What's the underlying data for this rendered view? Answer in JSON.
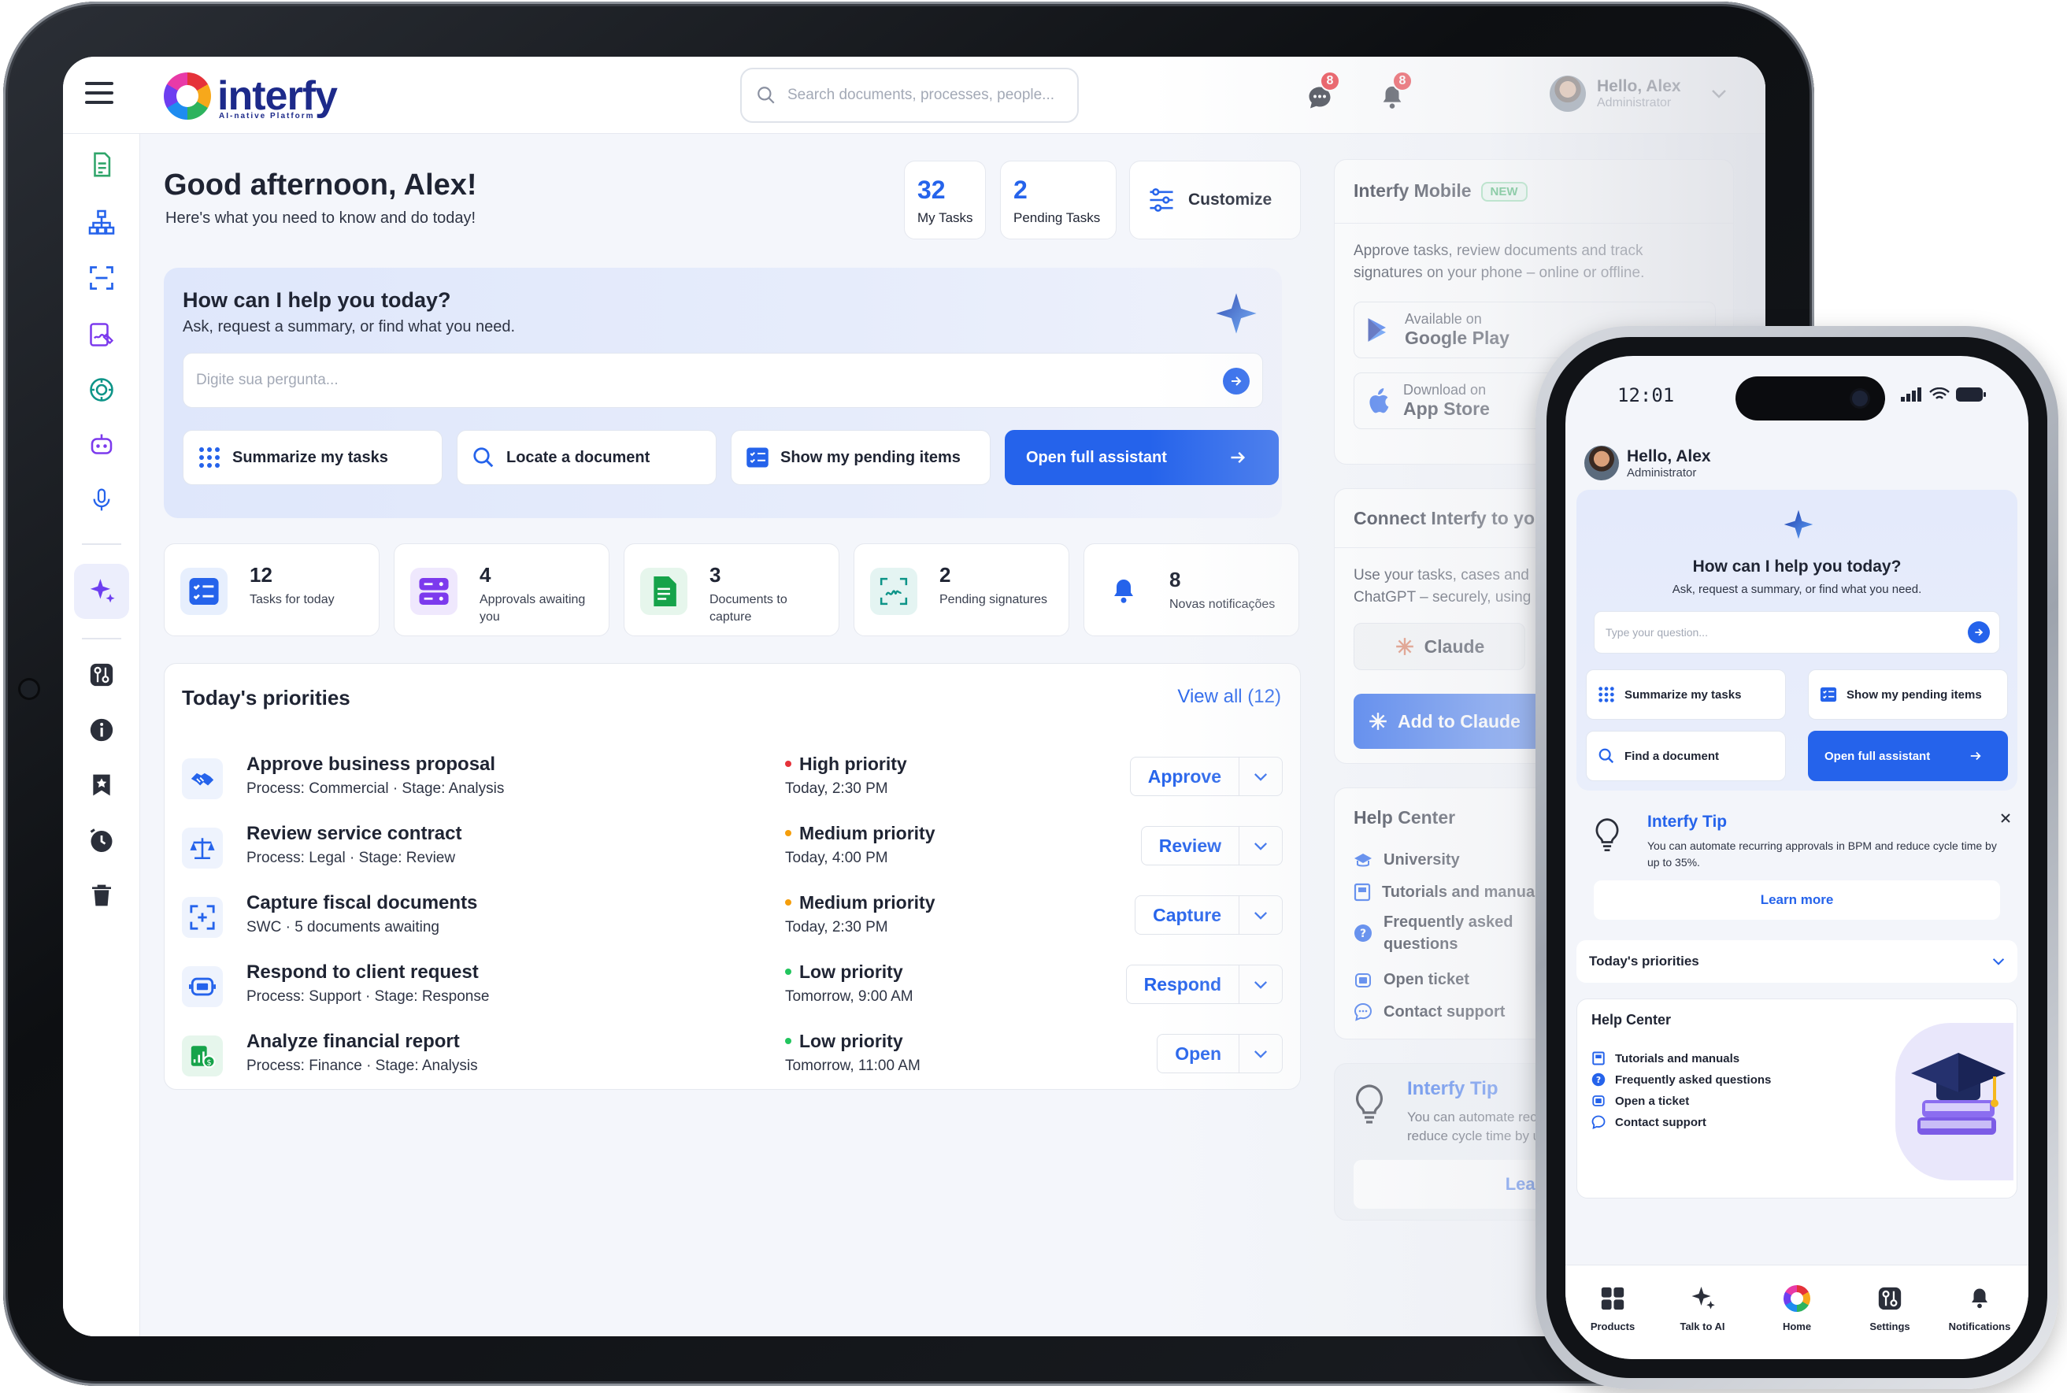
{
  "tablet": {
    "logo": {
      "name": "interfy",
      "tagline": "AI-native Platform"
    },
    "search": {
      "placeholder": "Search documents, processes, people..."
    },
    "chat_badge": "8",
    "notif_badge": "8",
    "user": {
      "greeting": "Hello, Alex",
      "role": "Administrator"
    },
    "greeting": {
      "title": "Good afternoon, Alex!",
      "subtitle": "Here's what you need to know and do today!"
    },
    "kpis": [
      {
        "value": "32",
        "label": "My Tasks"
      },
      {
        "value": "2",
        "label": "Pending Tasks"
      }
    ],
    "customize_label": "Customize",
    "assistant": {
      "title": "How can I help you today?",
      "subtitle": "Ask, request a summary, or find what you need.",
      "placeholder": "Digite sua pergunta...",
      "actions": [
        "Summarize my tasks",
        "Locate a document",
        "Show my pending items"
      ],
      "open_label": "Open full assistant"
    },
    "stats": [
      {
        "value": "12",
        "label": "Tasks for today",
        "color": "#2563eb"
      },
      {
        "value": "4",
        "label": "Approvals awaiting you",
        "color": "#7c3aed"
      },
      {
        "value": "3",
        "label": "Documents to capture",
        "color": "#16a34a"
      },
      {
        "value": "2",
        "label": "Pending signatures",
        "color": "#0d9488"
      },
      {
        "value": "8",
        "label": "Novas notificações",
        "color": "#2563eb"
      }
    ],
    "priorities": {
      "title": "Today's priorities",
      "view_all": "View all (12)",
      "rows": [
        {
          "title": "Approve business proposal",
          "sub": "Process: Commercial · Stage: Analysis",
          "priority": "High priority",
          "dot": "#e5323a",
          "time": "Today, 2:30 PM",
          "action": "Approve"
        },
        {
          "title": "Review service contract",
          "sub": "Process: Legal · Stage: Review",
          "priority": "Medium priority",
          "dot": "#f59e0b",
          "time": "Today, 4:00 PM",
          "action": "Review"
        },
        {
          "title": "Capture fiscal documents",
          "sub": "SWC · 5 documents awaiting",
          "priority": "Medium priority",
          "dot": "#f59e0b",
          "time": "Today, 2:30 PM",
          "action": "Capture"
        },
        {
          "title": "Respond to client request",
          "sub": "Process: Support · Stage: Response",
          "priority": "Low priority",
          "dot": "#22c55e",
          "time": "Tomorrow, 9:00 AM",
          "action": "Respond"
        },
        {
          "title": "Analyze financial report",
          "sub": "Process: Finance · Stage: Analysis",
          "priority": "Low priority",
          "dot": "#22c55e",
          "time": "Tomorrow, 11:00 AM",
          "action": "Open"
        }
      ]
    },
    "mobile": {
      "title": "Interfy Mobile",
      "tag": "NEW",
      "desc": "Approve tasks, review documents and track signatures on your phone – online or offline.",
      "gplay": {
        "l1": "Available on",
        "l2": "Google Play"
      },
      "appstore": {
        "l1": "Download on",
        "l2": "App Store"
      }
    },
    "connect": {
      "title": "Connect Interfy to you",
      "desc": "Use your tasks, cases and ChatGPT – securely, using",
      "claude": "Claude",
      "add_claude": "Add to Claude"
    },
    "help": {
      "title": "Help Center",
      "items": [
        "University",
        "Tutorials and manuals",
        "Frequently asked questions",
        "Open ticket",
        "Contact support"
      ]
    },
    "tip": {
      "title": "Interfy Tip",
      "text": "You can automate recu reduce cycle time by u",
      "learn": "Learn r"
    }
  },
  "phone": {
    "time": "12:01",
    "user": {
      "greeting": "Hello, Alex",
      "role": "Administrator"
    },
    "assistant": {
      "title": "How can I help you today?",
      "subtitle": "Ask, request a summary, or find what you need.",
      "placeholder": "Type your question...",
      "summarize": "Summarize my tasks",
      "pending": "Show my pending items",
      "find": "Find a document",
      "open": "Open full assistant"
    },
    "tip": {
      "title": "Interfy Tip",
      "text": "You can automate recurring approvals in BPM and reduce cycle time by up to 35%.",
      "learn": "Learn more"
    },
    "priorities_label": "Today's priorities",
    "help": {
      "title": "Help Center",
      "items": [
        "Tutorials and manuals",
        "Frequently asked questions",
        "Open a ticket",
        "Contact support"
      ]
    },
    "nav": [
      "Products",
      "Talk to AI",
      "Home",
      "Settings",
      "Notifications"
    ]
  }
}
